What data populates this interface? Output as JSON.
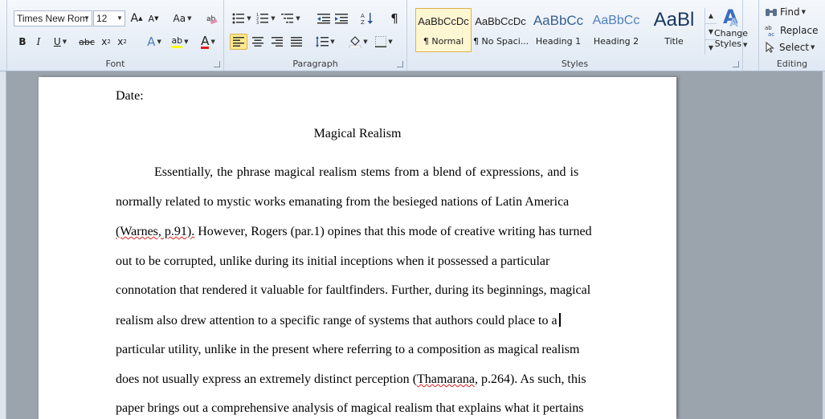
{
  "ribbon": {
    "font": {
      "group_label": "Font",
      "font_name": "Times New Rom",
      "font_size": "12",
      "grow_font": "A",
      "shrink_font": "A",
      "change_case": "Aa",
      "bold": "B",
      "italic": "I",
      "underline": "U",
      "strikethrough": "abc",
      "subscript": "x",
      "superscript": "x",
      "text_effects": "A",
      "highlight": "ab",
      "font_color": "A"
    },
    "paragraph": {
      "group_label": "Paragraph",
      "show_marks": "¶"
    },
    "styles": {
      "group_label": "Styles",
      "items": [
        {
          "sample": "AaBbCcDc",
          "name": "¶ Normal",
          "color": "#000000"
        },
        {
          "sample": "AaBbCcDc",
          "name": "¶ No Spaci...",
          "color": "#000000"
        },
        {
          "sample": "AaBbCc",
          "name": "Heading 1",
          "color": "#365f91"
        },
        {
          "sample": "AaBbCc",
          "name": "Heading 2",
          "color": "#4f81bd"
        },
        {
          "sample": "AaBl",
          "name": "Title",
          "color": "#17365d"
        }
      ],
      "change_styles_line1": "Change",
      "change_styles_line2": "Styles"
    },
    "editing": {
      "group_label": "Editing",
      "find": "Find",
      "replace": "Replace",
      "select": "Select"
    }
  },
  "document": {
    "date_line": "Date:",
    "title": "Magical Realism",
    "lines": [
      "Essentially, the phrase magical realism stems from a blend of expressions, and is",
      "normally related to mystic works emanating from the besieged nations of Latin America",
      "However, Rogers (par.1) opines that this mode of creative writing has turned",
      "out to be corrupted, unlike during its initial inceptions when it possessed a particular",
      "connotation that rendered it valuable for faultfinders. Further, during its beginnings, magical",
      "realism also drew attention to a specific range of systems that authors could place to a",
      "particular utility, unlike in the present where referring to a composition as magical realism",
      "does not usually express an extremely distinct perception",
      "As such, this",
      "paper brings out a comprehensive analysis of magical realism that explains what it pertains"
    ],
    "citation_warnes": "(Warnes, p.91).",
    "citation_thamarana_open": "(",
    "citation_thamarana_name": "Thamarana",
    "citation_thamarana_rest": ", p.264)."
  },
  "colors": {
    "accent": "#e2b04a",
    "ribbon_bg": "#dfe8f3",
    "spell_error": "#e02020"
  }
}
